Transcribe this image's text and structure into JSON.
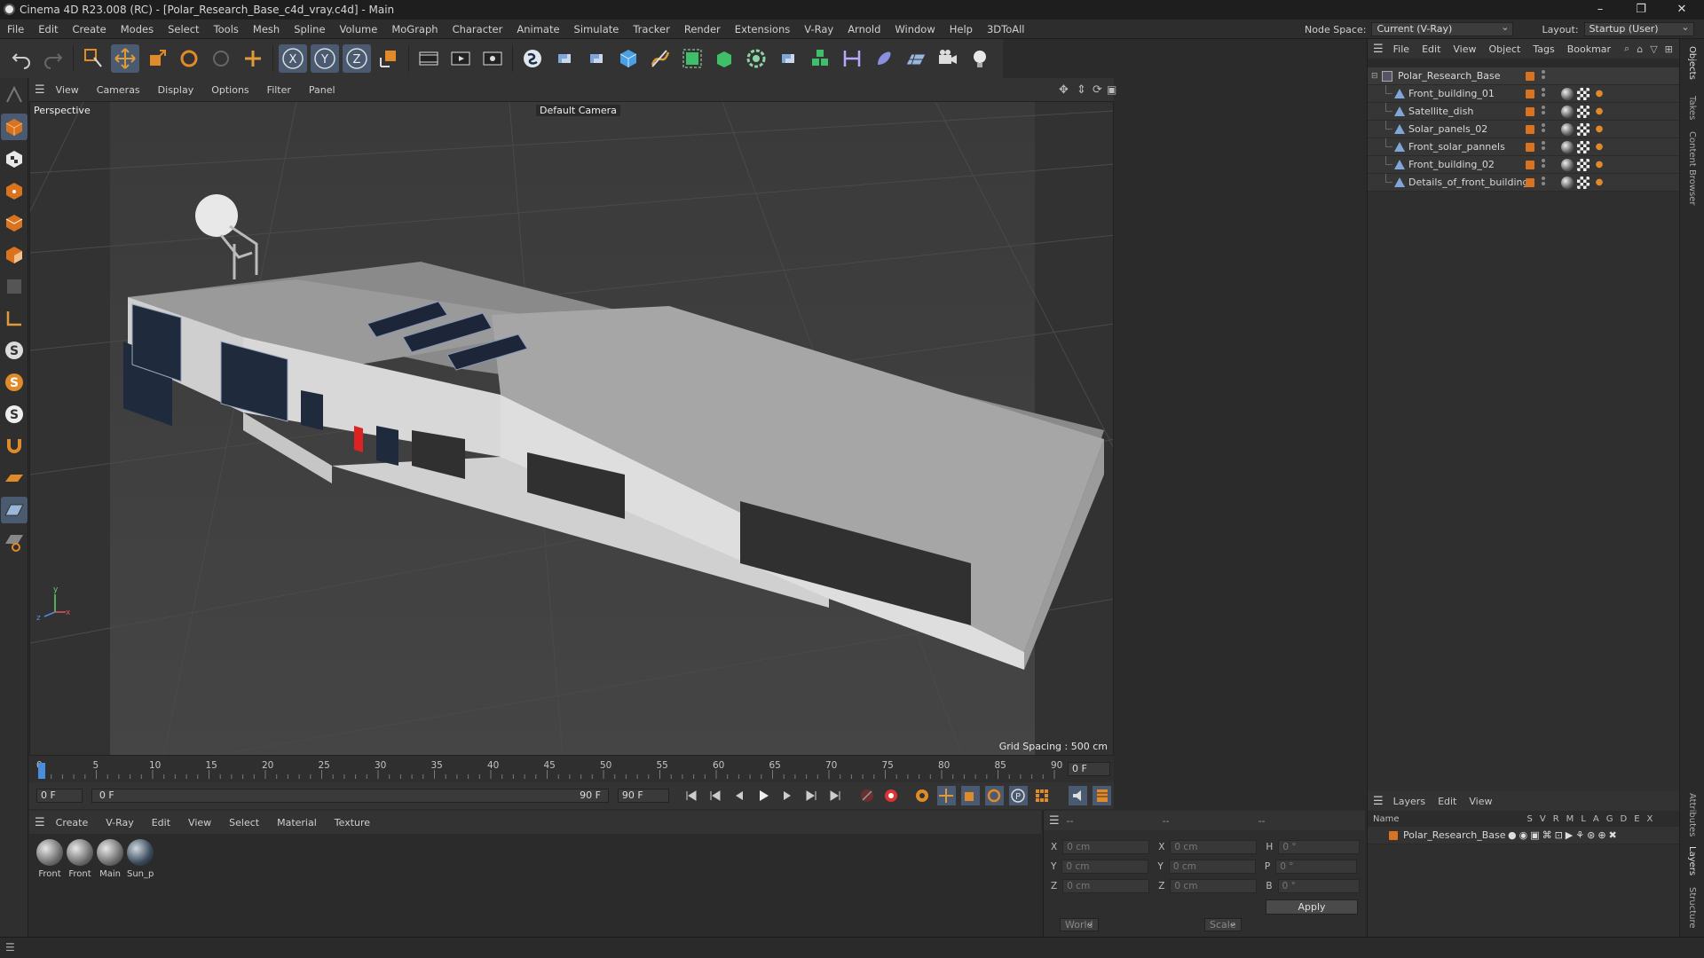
{
  "window": {
    "title": "Cinema 4D R23.008 (RC) - [Polar_Research_Base_c4d_vray.c4d] - Main"
  },
  "menubar": {
    "items": [
      "File",
      "Edit",
      "Create",
      "Modes",
      "Select",
      "Tools",
      "Mesh",
      "Spline",
      "Volume",
      "MoGraph",
      "Character",
      "Animate",
      "Simulate",
      "Tracker",
      "Render",
      "Extensions",
      "V-Ray",
      "Arnold",
      "Window",
      "Help",
      "3DToAll"
    ]
  },
  "header": {
    "node_space_label": "Node Space:",
    "node_space_value": "Current (V-Ray)",
    "layout_label": "Layout:",
    "layout_value": "Startup (User)"
  },
  "viewport": {
    "menu": [
      "View",
      "Cameras",
      "Display",
      "Options",
      "Filter",
      "Panel"
    ],
    "mode_label": "Perspective",
    "camera_label": "Default Camera",
    "grid_spacing": "Grid Spacing : 500 cm"
  },
  "timeline": {
    "ticks": [
      "0",
      "5",
      "10",
      "15",
      "20",
      "25",
      "30",
      "35",
      "40",
      "45",
      "50",
      "55",
      "60",
      "65",
      "70",
      "75",
      "80",
      "85",
      "90"
    ],
    "current_frame_field": "0 F",
    "start_field": "0 F",
    "range_start": "0 F",
    "range_end": "90 F",
    "end_field": "90 F"
  },
  "materials": {
    "menu": [
      "Create",
      "V-Ray",
      "Edit",
      "View",
      "Select",
      "Material",
      "Texture"
    ],
    "items": [
      "Front",
      "Front",
      "Main",
      "Sun_p"
    ]
  },
  "coords": {
    "header_1": "--",
    "header_2": "--",
    "header_3": "--",
    "rows": [
      {
        "a": "X",
        "av": "0 cm",
        "b": "X",
        "bv": "0 cm",
        "c": "H",
        "cv": "0 °"
      },
      {
        "a": "Y",
        "av": "0 cm",
        "b": "Y",
        "bv": "0 cm",
        "c": "P",
        "cv": "0 °"
      },
      {
        "a": "Z",
        "av": "0 cm",
        "b": "Z",
        "bv": "0 cm",
        "c": "B",
        "cv": "0 °"
      }
    ],
    "world_label": "World",
    "scale_label": "Scale",
    "apply_label": "Apply"
  },
  "objects": {
    "menu": [
      "File",
      "Edit",
      "View",
      "Object",
      "Tags",
      "Bookmar"
    ],
    "root": "Polar_Research_Base",
    "children": [
      "Front_building_01",
      "Satellite_dish",
      "Solar_panels_02",
      "Front_solar_pannels",
      "Front_building_02",
      "Details_of_front_building"
    ]
  },
  "layers": {
    "menu": [
      "Layers",
      "Edit",
      "View"
    ],
    "columns": [
      "Name",
      "S",
      "V",
      "R",
      "M",
      "L",
      "A",
      "G",
      "D",
      "E",
      "X"
    ],
    "rows": [
      "Polar_Research_Base"
    ]
  },
  "side_tabs": [
    "Objects",
    "Takes",
    "Content Browser",
    "Attributes",
    "Layers",
    "Structure"
  ],
  "colors": {
    "accent_orange": "#d9731f",
    "panel_bg": "#2f2f2f",
    "viewport_bg": "#3c3c3c"
  }
}
